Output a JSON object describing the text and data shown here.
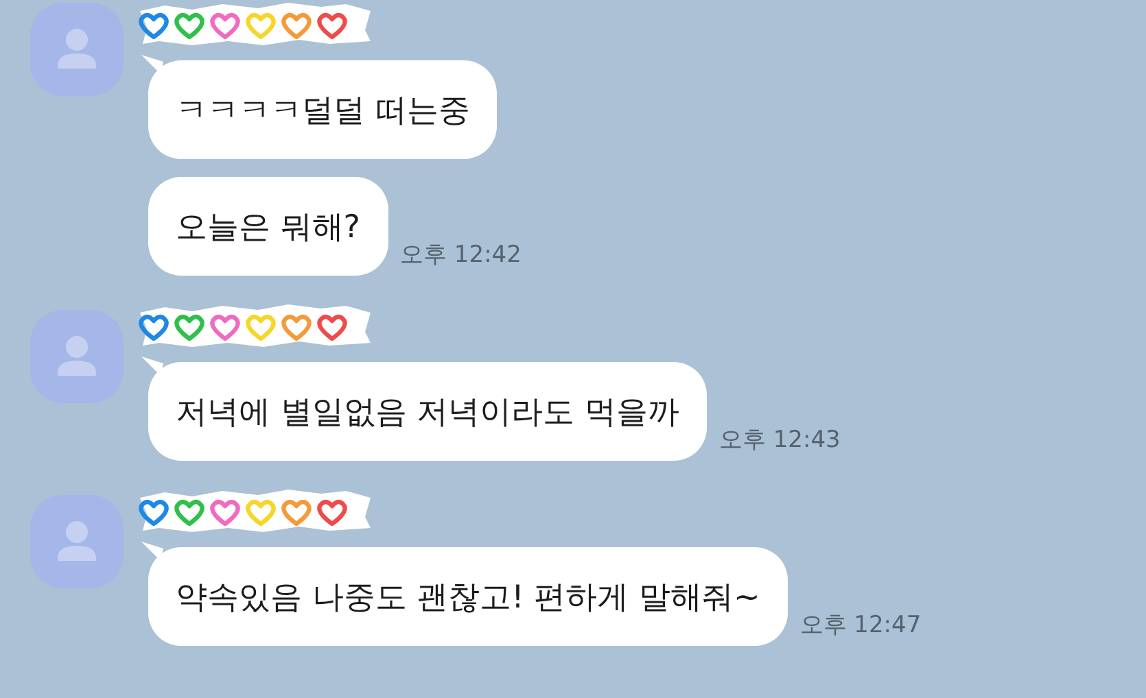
{
  "groups": [
    {
      "messages": [
        {
          "text": "ㅋㅋㅋㅋ덜덜 떠는중"
        },
        {
          "text": "오늘은 뭐해?",
          "time": "오후 12:42"
        }
      ]
    },
    {
      "messages": [
        {
          "text": "저녁에 별일없음 저녁이라도 먹을까",
          "time": "오후 12:43"
        }
      ]
    },
    {
      "messages": [
        {
          "text": "약속있음 나중도 괜찮고! 편하게 말해줘~",
          "time": "오후 12:47"
        }
      ]
    }
  ]
}
